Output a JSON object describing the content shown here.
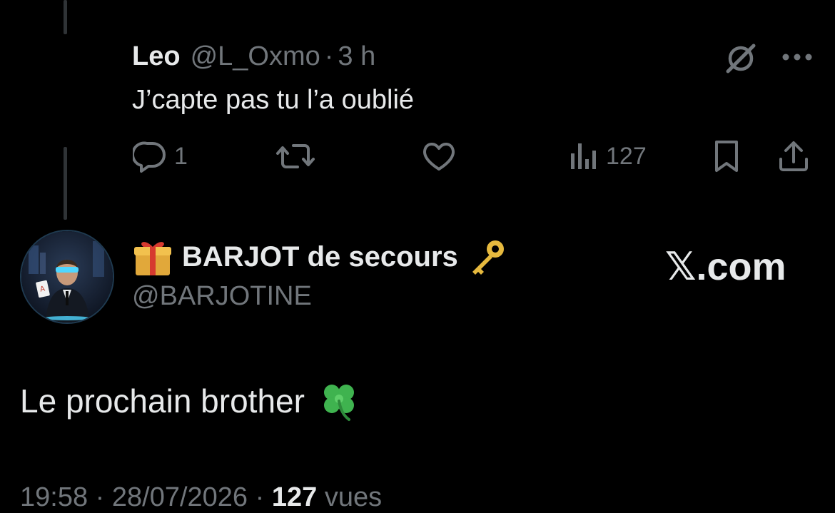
{
  "reply": {
    "name": "Leo",
    "handle": "@L_Oxmo",
    "separator": "·",
    "time": "3 h",
    "text": "J’capte pas tu l’a oublié",
    "actions": {
      "reply_count": "1",
      "retweet_count": "",
      "like_count": "",
      "views_count": "127"
    }
  },
  "main_tweet": {
    "author_name": "BARJOT de secours",
    "author_handle": "@BARJOTINE",
    "name_prefix_emoji": "gift-emoji",
    "name_suffix_emoji": "key-emoji",
    "watermark": "𝕏.com",
    "text": "Le prochain brother",
    "text_emoji": "four-leaf-clover-emoji",
    "meta": {
      "time": "19:58",
      "separator": " · ",
      "date": "28/07/2026",
      "views_count": "127",
      "views_label": "vues"
    }
  },
  "colors": {
    "background": "#000000",
    "text_primary": "#e7e9ea",
    "text_secondary": "#71767b",
    "thread_line": "#2f3336"
  }
}
